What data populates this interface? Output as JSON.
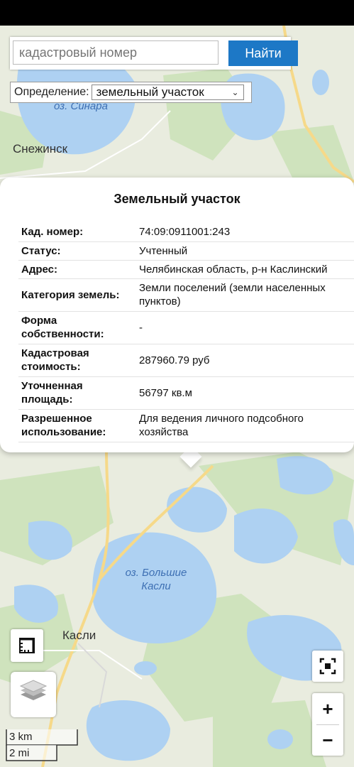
{
  "search": {
    "placeholder": "кадастровый номер",
    "button_label": "Найти"
  },
  "definition": {
    "label": "Определение:",
    "selected": "земельный участок"
  },
  "map_labels": {
    "city_snezhinsk": "Снежинск",
    "city_kasli": "Касли",
    "lake_sinara": "оз. Синара",
    "lake_bolshie_kasli_1": "оз. Большие",
    "lake_bolshie_kasli_2": "Касли"
  },
  "popup": {
    "title": "Земельный участок",
    "rows": [
      {
        "key": "Кад. номер:",
        "value": "74:09:0911001:243"
      },
      {
        "key": "Статус:",
        "value": "Учтенный"
      },
      {
        "key": "Адрес:",
        "value": "Челябинская область, р-н Каслинский"
      },
      {
        "key": "Категория земель:",
        "value": "Земли поселений (земли населенных пунктов)"
      },
      {
        "key": "Форма собственности:",
        "value": "-"
      },
      {
        "key": "Кадастровая стоимость:",
        "value": "287960.79 руб"
      },
      {
        "key": "Уточненная площадь:",
        "value": "56797 кв.м"
      },
      {
        "key": "Разрешенное использование:",
        "value": "Для ведения личного подсобного хозяйства"
      }
    ]
  },
  "controls": {
    "zoom_in": "+",
    "zoom_out": "−"
  },
  "scale": {
    "km": "3 km",
    "mi": "2 mi"
  },
  "colors": {
    "water": "#aed1f2",
    "land": "#e9ecdf",
    "forest": "#cfe3bd",
    "road": "#f6d989",
    "accent": "#1d78c6"
  }
}
